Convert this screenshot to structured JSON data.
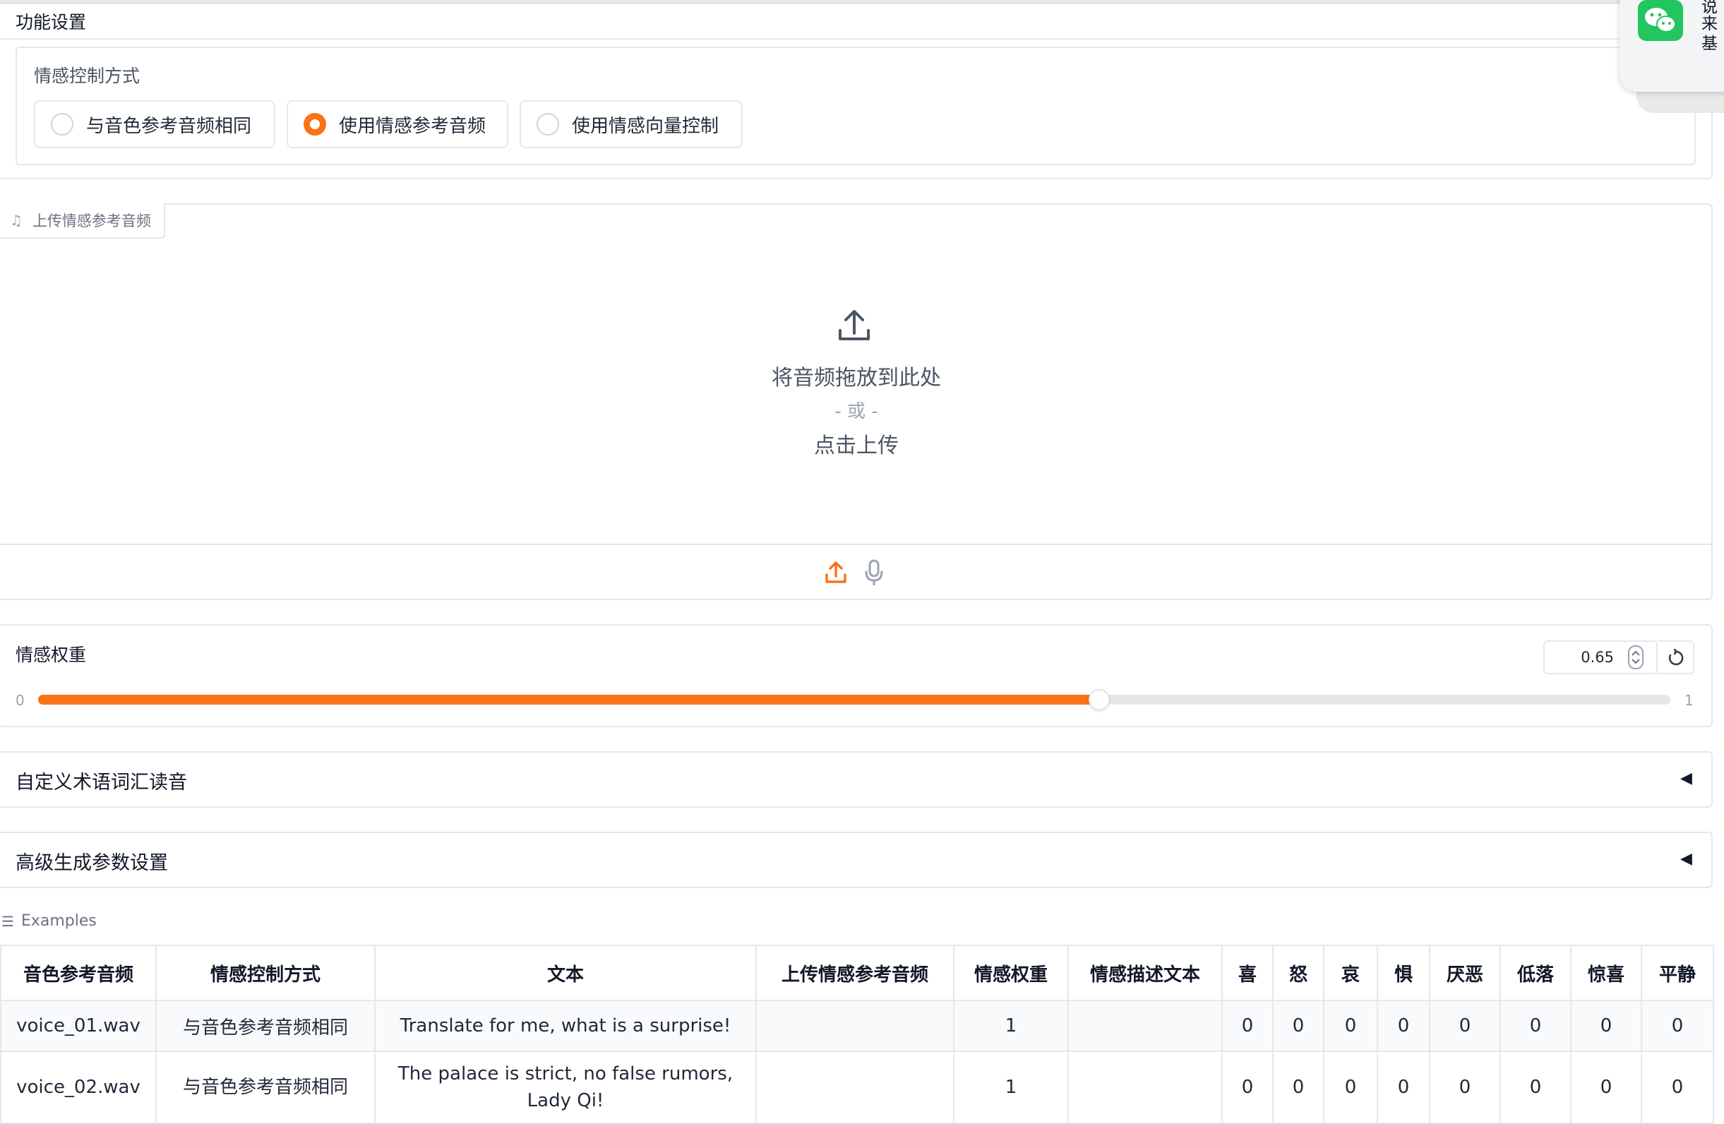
{
  "function_settings": {
    "title": "功能设置",
    "emotion_control": {
      "label": "情感控制方式",
      "options": [
        {
          "label": "与音色参考音频相同",
          "checked": false
        },
        {
          "label": "使用情感参考音频",
          "checked": true
        },
        {
          "label": "使用情感向量控制",
          "checked": false
        }
      ]
    }
  },
  "upload": {
    "tab_label": "上传情感参考音频",
    "tab_icon": "music-note-icon",
    "drop_text": "将音频拖放到此处",
    "or_text": "- 或 -",
    "click_text": "点击上传",
    "source_icons": [
      "upload-icon",
      "microphone-icon"
    ]
  },
  "emotion_weight": {
    "label": "情感权重",
    "value": "0.65",
    "min": "0",
    "max": "1",
    "fraction": 0.65
  },
  "accordions": [
    {
      "title": "自定义术语词汇读音",
      "arrow": "◀"
    },
    {
      "title": "高级生成参数设置",
      "arrow": "◀"
    }
  ],
  "examples": {
    "label": "Examples",
    "columns": [
      "音色参考音频",
      "情感控制方式",
      "文本",
      "上传情感参考音频",
      "情感权重",
      "情感描述文本",
      "喜",
      "怒",
      "哀",
      "惧",
      "厌恶",
      "低落",
      "惊喜",
      "平静"
    ],
    "rows": [
      [
        "voice_01.wav",
        "与音色参考音频相同",
        "Translate for me, what is a surprise!",
        "",
        "1",
        "",
        "0",
        "0",
        "0",
        "0",
        "0",
        "0",
        "0",
        "0"
      ],
      [
        "voice_02.wav",
        "与音色参考音频相同",
        "The palace is strict, no false rumors, Lady Qi!",
        "",
        "1",
        "",
        "0",
        "0",
        "0",
        "0",
        "0",
        "0",
        "0",
        "0"
      ]
    ]
  },
  "notification": {
    "lines": [
      "说",
      "来",
      "基"
    ],
    "app_icon": "wechat-icon"
  },
  "colors": {
    "accent": "#f97316",
    "border": "#e5e7eb",
    "wechat": "#22c55e"
  }
}
